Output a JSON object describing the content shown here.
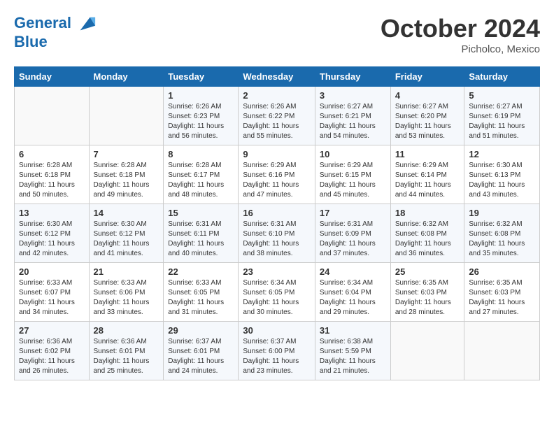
{
  "header": {
    "logo_line1": "General",
    "logo_line2": "Blue",
    "month": "October 2024",
    "location": "Picholco, Mexico"
  },
  "weekdays": [
    "Sunday",
    "Monday",
    "Tuesday",
    "Wednesday",
    "Thursday",
    "Friday",
    "Saturday"
  ],
  "weeks": [
    [
      {
        "day": "",
        "info": ""
      },
      {
        "day": "",
        "info": ""
      },
      {
        "day": "1",
        "info": "Sunrise: 6:26 AM\nSunset: 6:23 PM\nDaylight: 11 hours and 56 minutes."
      },
      {
        "day": "2",
        "info": "Sunrise: 6:26 AM\nSunset: 6:22 PM\nDaylight: 11 hours and 55 minutes."
      },
      {
        "day": "3",
        "info": "Sunrise: 6:27 AM\nSunset: 6:21 PM\nDaylight: 11 hours and 54 minutes."
      },
      {
        "day": "4",
        "info": "Sunrise: 6:27 AM\nSunset: 6:20 PM\nDaylight: 11 hours and 53 minutes."
      },
      {
        "day": "5",
        "info": "Sunrise: 6:27 AM\nSunset: 6:19 PM\nDaylight: 11 hours and 51 minutes."
      }
    ],
    [
      {
        "day": "6",
        "info": "Sunrise: 6:28 AM\nSunset: 6:18 PM\nDaylight: 11 hours and 50 minutes."
      },
      {
        "day": "7",
        "info": "Sunrise: 6:28 AM\nSunset: 6:18 PM\nDaylight: 11 hours and 49 minutes."
      },
      {
        "day": "8",
        "info": "Sunrise: 6:28 AM\nSunset: 6:17 PM\nDaylight: 11 hours and 48 minutes."
      },
      {
        "day": "9",
        "info": "Sunrise: 6:29 AM\nSunset: 6:16 PM\nDaylight: 11 hours and 47 minutes."
      },
      {
        "day": "10",
        "info": "Sunrise: 6:29 AM\nSunset: 6:15 PM\nDaylight: 11 hours and 45 minutes."
      },
      {
        "day": "11",
        "info": "Sunrise: 6:29 AM\nSunset: 6:14 PM\nDaylight: 11 hours and 44 minutes."
      },
      {
        "day": "12",
        "info": "Sunrise: 6:30 AM\nSunset: 6:13 PM\nDaylight: 11 hours and 43 minutes."
      }
    ],
    [
      {
        "day": "13",
        "info": "Sunrise: 6:30 AM\nSunset: 6:12 PM\nDaylight: 11 hours and 42 minutes."
      },
      {
        "day": "14",
        "info": "Sunrise: 6:30 AM\nSunset: 6:12 PM\nDaylight: 11 hours and 41 minutes."
      },
      {
        "day": "15",
        "info": "Sunrise: 6:31 AM\nSunset: 6:11 PM\nDaylight: 11 hours and 40 minutes."
      },
      {
        "day": "16",
        "info": "Sunrise: 6:31 AM\nSunset: 6:10 PM\nDaylight: 11 hours and 38 minutes."
      },
      {
        "day": "17",
        "info": "Sunrise: 6:31 AM\nSunset: 6:09 PM\nDaylight: 11 hours and 37 minutes."
      },
      {
        "day": "18",
        "info": "Sunrise: 6:32 AM\nSunset: 6:08 PM\nDaylight: 11 hours and 36 minutes."
      },
      {
        "day": "19",
        "info": "Sunrise: 6:32 AM\nSunset: 6:08 PM\nDaylight: 11 hours and 35 minutes."
      }
    ],
    [
      {
        "day": "20",
        "info": "Sunrise: 6:33 AM\nSunset: 6:07 PM\nDaylight: 11 hours and 34 minutes."
      },
      {
        "day": "21",
        "info": "Sunrise: 6:33 AM\nSunset: 6:06 PM\nDaylight: 11 hours and 33 minutes."
      },
      {
        "day": "22",
        "info": "Sunrise: 6:33 AM\nSunset: 6:05 PM\nDaylight: 11 hours and 31 minutes."
      },
      {
        "day": "23",
        "info": "Sunrise: 6:34 AM\nSunset: 6:05 PM\nDaylight: 11 hours and 30 minutes."
      },
      {
        "day": "24",
        "info": "Sunrise: 6:34 AM\nSunset: 6:04 PM\nDaylight: 11 hours and 29 minutes."
      },
      {
        "day": "25",
        "info": "Sunrise: 6:35 AM\nSunset: 6:03 PM\nDaylight: 11 hours and 28 minutes."
      },
      {
        "day": "26",
        "info": "Sunrise: 6:35 AM\nSunset: 6:03 PM\nDaylight: 11 hours and 27 minutes."
      }
    ],
    [
      {
        "day": "27",
        "info": "Sunrise: 6:36 AM\nSunset: 6:02 PM\nDaylight: 11 hours and 26 minutes."
      },
      {
        "day": "28",
        "info": "Sunrise: 6:36 AM\nSunset: 6:01 PM\nDaylight: 11 hours and 25 minutes."
      },
      {
        "day": "29",
        "info": "Sunrise: 6:37 AM\nSunset: 6:01 PM\nDaylight: 11 hours and 24 minutes."
      },
      {
        "day": "30",
        "info": "Sunrise: 6:37 AM\nSunset: 6:00 PM\nDaylight: 11 hours and 23 minutes."
      },
      {
        "day": "31",
        "info": "Sunrise: 6:38 AM\nSunset: 5:59 PM\nDaylight: 11 hours and 21 minutes."
      },
      {
        "day": "",
        "info": ""
      },
      {
        "day": "",
        "info": ""
      }
    ]
  ]
}
